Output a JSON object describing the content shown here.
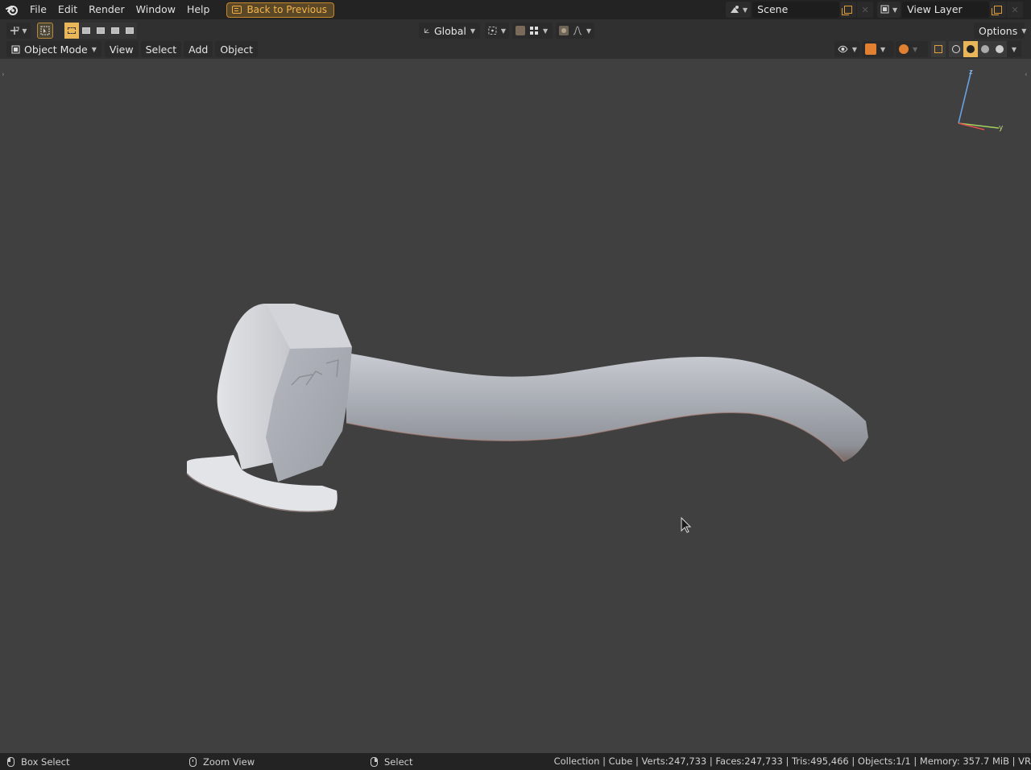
{
  "topbar": {
    "menu": [
      "File",
      "Edit",
      "Render",
      "Window",
      "Help"
    ],
    "back_button": "Back to Previous",
    "scene_name": "Scene",
    "view_layer_name": "View Layer"
  },
  "header1": {
    "orientation": "Global",
    "options_label": "Options"
  },
  "header2": {
    "mode": "Object Mode",
    "menu": [
      "View",
      "Select",
      "Add",
      "Object"
    ]
  },
  "gizmo": {
    "z": "z",
    "y": "y"
  },
  "status": {
    "left_action": "Box Select",
    "middle_action": "Zoom View",
    "right_action": "Select",
    "stats": "Collection | Cube | Verts:247,733 | Faces:247,733 | Tris:495,466 | Objects:1/1 | Memory: 357.7 MiB | VR"
  },
  "colors": {
    "accent": "#eab65a",
    "viewport_bg": "#404040",
    "topbar_bg": "#232323"
  }
}
